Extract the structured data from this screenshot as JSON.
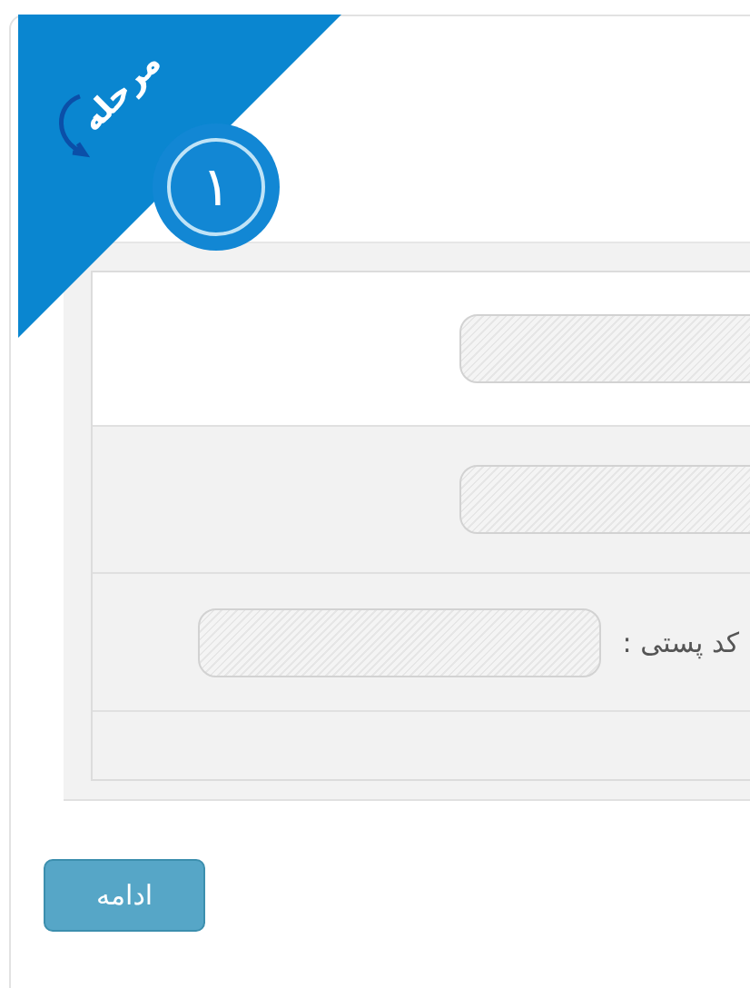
{
  "step": {
    "label": "مرحله",
    "number": "١"
  },
  "rows": [
    {
      "kind": "field",
      "highlighted": true
    },
    {
      "kind": "field",
      "highlighted": false
    },
    {
      "kind": "field",
      "highlighted": false,
      "label": "کد پستی :"
    },
    {
      "kind": "empty",
      "highlighted": false
    }
  ],
  "button": "ادامه"
}
